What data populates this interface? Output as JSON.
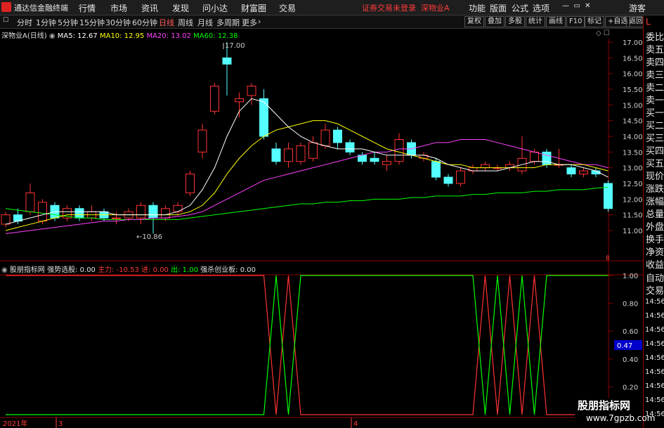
{
  "topbar": {
    "app_name": "通达信金融终端",
    "menu": [
      "行情",
      "市场",
      "资讯",
      "发现",
      "问小达",
      "财富圈",
      "交易"
    ],
    "status": "证券交易未登录",
    "stock": "深物业A",
    "right": [
      "功能",
      "版面",
      "公式",
      "选项"
    ],
    "guest": "游客"
  },
  "toolbar": {
    "timeframes": [
      "分时",
      "1分钟",
      "5分钟",
      "15分钟",
      "30分钟",
      "60分钟",
      "日线",
      "周线",
      "月线",
      "多周期",
      "更多"
    ],
    "active_timeframe": "日线",
    "buttons": [
      "复权",
      "叠加",
      "多股",
      "统计",
      "画线",
      "F10",
      "标记",
      "+自选",
      "返回"
    ]
  },
  "main": {
    "title": "深物业A(日线)",
    "ma": [
      {
        "label": "MA5: 12.67",
        "color": "#ffffff"
      },
      {
        "label": "MA10: 12.95",
        "color": "#ffff00"
      },
      {
        "label": "MA20: 13.02",
        "color": "#ff40ff"
      },
      {
        "label": "MA60: 12.38",
        "color": "#00ff00"
      }
    ],
    "high_label": "17.00",
    "low_label": "10.86",
    "y_ticks": [
      "17.00",
      "16.50",
      "16.00",
      "15.50",
      "15.00",
      "14.50",
      "14.00",
      "13.50",
      "13.00",
      "12.50",
      "12.00",
      "11.50",
      "11.00"
    ],
    "marker": "8"
  },
  "sub": {
    "name": "股朋指标网",
    "strong_label": "强势选股: 0.00",
    "main_label": "主力: -10.53",
    "in_label": "进: 0.00",
    "out_label": "出: 1.00",
    "board_label": "强杀创业板: 0.00",
    "y_ticks": [
      "1.00",
      "0.80",
      "0.60",
      "0.40",
      "0.20"
    ],
    "value_box": "0.47"
  },
  "xaxis": {
    "year": "2021年",
    "m1": "3",
    "m2": "4"
  },
  "right_panel": {
    "top": "L",
    "labels": [
      "委比",
      "卖五",
      "卖四",
      "卖三",
      "卖二",
      "卖一",
      "买一",
      "买二",
      "买三",
      "买四",
      "买五",
      "现价",
      "涨跌",
      "涨幅",
      "总量",
      "外盘",
      "换手",
      "净资",
      "收益"
    ],
    "lower": [
      "自动",
      "交易"
    ],
    "times": [
      "14:56",
      "14:56",
      "14:56",
      "14:56",
      "14:56",
      "14:56",
      "14:56",
      "14:56",
      "14:56"
    ]
  },
  "watermark": {
    "title": "股朋指标网",
    "url": "www.7gpzb.com"
  },
  "chart_data": {
    "type": "candlestick",
    "price_axis": [
      11.0,
      17.0
    ],
    "candles": [
      {
        "o": 11.2,
        "c": 11.5,
        "h": 11.6,
        "l": 11.1
      },
      {
        "o": 11.5,
        "c": 11.3,
        "h": 11.7,
        "l": 11.2
      },
      {
        "o": 11.6,
        "c": 12.2,
        "h": 12.5,
        "l": 11.5
      },
      {
        "o": 11.3,
        "c": 11.9,
        "h": 12.0,
        "l": 11.2
      },
      {
        "o": 11.8,
        "c": 11.4,
        "h": 11.9,
        "l": 11.3
      },
      {
        "o": 11.4,
        "c": 11.7,
        "h": 11.8,
        "l": 11.3
      },
      {
        "o": 11.7,
        "c": 11.4,
        "h": 11.8,
        "l": 11.3
      },
      {
        "o": 11.4,
        "c": 11.6,
        "h": 11.8,
        "l": 11.3
      },
      {
        "o": 11.6,
        "c": 11.4,
        "h": 11.7,
        "l": 11.3
      },
      {
        "o": 11.4,
        "c": 11.4,
        "h": 11.6,
        "l": 11.2
      },
      {
        "o": 11.4,
        "c": 11.6,
        "h": 11.7,
        "l": 11.3
      },
      {
        "o": 11.4,
        "c": 11.8,
        "h": 11.9,
        "l": 11.2
      },
      {
        "o": 11.8,
        "c": 11.4,
        "h": 11.9,
        "l": 10.9
      },
      {
        "o": 11.4,
        "c": 11.7,
        "h": 11.8,
        "l": 11.3
      },
      {
        "o": 11.6,
        "c": 11.8,
        "h": 11.9,
        "l": 11.5
      },
      {
        "o": 12.2,
        "c": 12.8,
        "h": 12.9,
        "l": 12.1
      },
      {
        "o": 13.5,
        "c": 14.2,
        "h": 14.4,
        "l": 13.3
      },
      {
        "o": 14.8,
        "c": 15.6,
        "h": 15.7,
        "l": 14.7
      },
      {
        "o": 16.5,
        "c": 16.3,
        "h": 17.0,
        "l": 15.3
      },
      {
        "o": 15.1,
        "c": 15.2,
        "h": 15.4,
        "l": 14.6
      },
      {
        "o": 15.3,
        "c": 15.6,
        "h": 15.7,
        "l": 15.0
      },
      {
        "o": 15.2,
        "c": 14.0,
        "h": 15.5,
        "l": 13.9
      },
      {
        "o": 13.6,
        "c": 13.2,
        "h": 13.8,
        "l": 13.1
      },
      {
        "o": 13.2,
        "c": 13.6,
        "h": 13.8,
        "l": 13.0
      },
      {
        "o": 13.2,
        "c": 13.7,
        "h": 13.8,
        "l": 13.1
      },
      {
        "o": 13.3,
        "c": 13.8,
        "h": 14.0,
        "l": 13.2
      },
      {
        "o": 13.7,
        "c": 14.2,
        "h": 14.4,
        "l": 13.6
      },
      {
        "o": 14.2,
        "c": 13.8,
        "h": 14.3,
        "l": 13.6
      },
      {
        "o": 13.8,
        "c": 13.5,
        "h": 13.9,
        "l": 13.4
      },
      {
        "o": 13.4,
        "c": 13.2,
        "h": 13.5,
        "l": 13.1
      },
      {
        "o": 13.3,
        "c": 13.2,
        "h": 13.5,
        "l": 13.1
      },
      {
        "o": 13.1,
        "c": 13.2,
        "h": 13.4,
        "l": 12.9
      },
      {
        "o": 13.2,
        "c": 13.9,
        "h": 14.1,
        "l": 13.1
      },
      {
        "o": 13.8,
        "c": 13.4,
        "h": 13.9,
        "l": 13.3
      },
      {
        "o": 13.3,
        "c": 13.4,
        "h": 13.5,
        "l": 13.2
      },
      {
        "o": 13.2,
        "c": 12.7,
        "h": 13.3,
        "l": 12.6
      },
      {
        "o": 12.7,
        "c": 12.5,
        "h": 12.8,
        "l": 12.4
      },
      {
        "o": 12.5,
        "c": 12.9,
        "h": 13.0,
        "l": 12.4
      },
      {
        "o": 12.9,
        "c": 13.0,
        "h": 13.1,
        "l": 12.8
      },
      {
        "o": 13.0,
        "c": 13.1,
        "h": 13.2,
        "l": 12.9
      },
      {
        "o": 13.0,
        "c": 13.0,
        "h": 13.1,
        "l": 12.9
      },
      {
        "o": 13.0,
        "c": 13.1,
        "h": 13.2,
        "l": 12.9
      },
      {
        "o": 12.9,
        "c": 13.3,
        "h": 14.0,
        "l": 12.8
      },
      {
        "o": 13.2,
        "c": 13.5,
        "h": 13.6,
        "l": 13.1
      },
      {
        "o": 13.5,
        "c": 13.1,
        "h": 13.6,
        "l": 13.0
      },
      {
        "o": 13.1,
        "c": 13.1,
        "h": 13.6,
        "l": 13.0
      },
      {
        "o": 13.0,
        "c": 12.8,
        "h": 13.1,
        "l": 12.7
      },
      {
        "o": 12.8,
        "c": 12.9,
        "h": 13.0,
        "l": 12.7
      },
      {
        "o": 12.9,
        "c": 12.8,
        "h": 13.0,
        "l": 12.7
      },
      {
        "o": 12.5,
        "c": 11.7,
        "h": 12.6,
        "l": 11.6
      }
    ],
    "ma5": [
      11.2,
      11.3,
      11.4,
      11.5,
      11.6,
      11.6,
      11.6,
      11.6,
      11.6,
      11.5,
      11.5,
      11.5,
      11.5,
      11.5,
      11.6,
      11.8,
      12.3,
      13.0,
      14.0,
      14.8,
      15.2,
      15.1,
      14.7,
      14.3,
      14.0,
      13.8,
      13.7,
      13.6,
      13.6,
      13.6,
      13.5,
      13.4,
      13.4,
      13.4,
      13.4,
      13.3,
      13.1,
      13.0,
      12.9,
      12.9,
      12.9,
      13.0,
      13.1,
      13.2,
      13.2,
      13.1,
      13.1,
      13.0,
      12.9,
      12.7
    ],
    "ma10": [
      11.0,
      11.1,
      11.2,
      11.3,
      11.4,
      11.5,
      11.5,
      11.5,
      11.5,
      11.5,
      11.5,
      11.5,
      11.5,
      11.5,
      11.5,
      11.6,
      11.8,
      12.2,
      12.8,
      13.3,
      13.7,
      14.0,
      14.2,
      14.3,
      14.4,
      14.5,
      14.5,
      14.4,
      14.2,
      14.0,
      13.8,
      13.6,
      13.5,
      13.4,
      13.3,
      13.2,
      13.1,
      13.1,
      13.0,
      13.0,
      13.0,
      13.0,
      13.0,
      13.0,
      13.1,
      13.1,
      13.1,
      13.1,
      13.0,
      12.9
    ],
    "ma20": [
      10.9,
      10.95,
      11.0,
      11.05,
      11.1,
      11.15,
      11.2,
      11.25,
      11.3,
      11.3,
      11.35,
      11.35,
      11.4,
      11.4,
      11.45,
      11.5,
      11.6,
      11.8,
      12.0,
      12.2,
      12.4,
      12.6,
      12.7,
      12.8,
      12.9,
      13.0,
      13.1,
      13.2,
      13.3,
      13.4,
      13.5,
      13.5,
      13.6,
      13.6,
      13.7,
      13.8,
      13.8,
      13.9,
      13.9,
      13.9,
      13.8,
      13.7,
      13.6,
      13.5,
      13.4,
      13.3,
      13.2,
      13.1,
      13.1,
      13.0
    ],
    "ma60": [
      11.7,
      11.65,
      11.6,
      11.55,
      11.5,
      11.45,
      11.4,
      11.4,
      11.35,
      11.35,
      11.35,
      11.35,
      11.35,
      11.35,
      11.35,
      11.4,
      11.45,
      11.5,
      11.55,
      11.6,
      11.65,
      11.7,
      11.75,
      11.8,
      11.85,
      11.85,
      11.9,
      11.9,
      11.95,
      11.95,
      12.0,
      12.0,
      12.0,
      12.05,
      12.05,
      12.1,
      12.1,
      12.1,
      12.15,
      12.15,
      12.2,
      12.2,
      12.2,
      12.25,
      12.25,
      12.3,
      12.3,
      12.3,
      12.35,
      12.38
    ],
    "sub_red": [
      1,
      1,
      1,
      1,
      1,
      1,
      1,
      1,
      1,
      1,
      1,
      1,
      1,
      1,
      1,
      1,
      1,
      1,
      1,
      1,
      1,
      1,
      0,
      1,
      0,
      0,
      0,
      0,
      0,
      0,
      0,
      0,
      0,
      0,
      0,
      0,
      0,
      0,
      0,
      1,
      0,
      1,
      0,
      1,
      0,
      0,
      0,
      0,
      0,
      0
    ],
    "sub_green": [
      0,
      0,
      0,
      0,
      0,
      0,
      0,
      0,
      0,
      0,
      0,
      0,
      0,
      0,
      0,
      0,
      0,
      0,
      0,
      0,
      0,
      0,
      1,
      0,
      1,
      1,
      1,
      1,
      1,
      1,
      1,
      1,
      1,
      1,
      1,
      1,
      1,
      1,
      1,
      0,
      1,
      0,
      1,
      0,
      1,
      1,
      1,
      1,
      1,
      1
    ]
  }
}
